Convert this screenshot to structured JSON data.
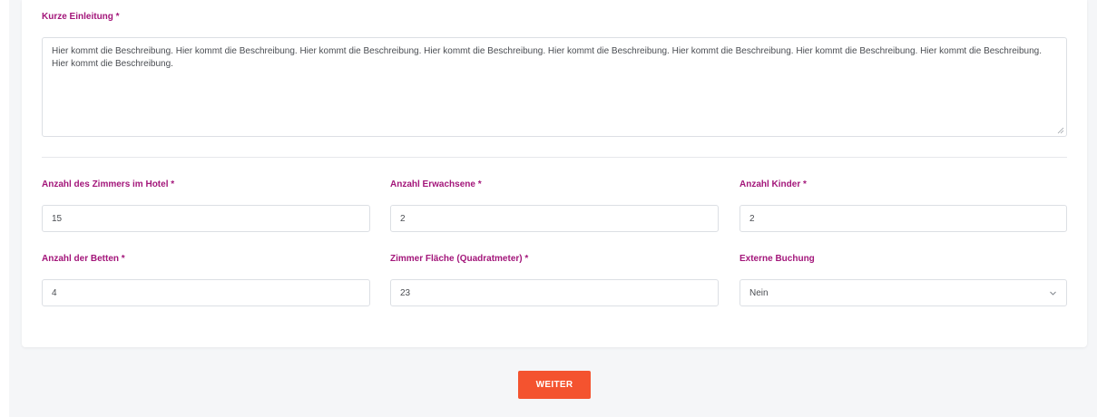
{
  "form": {
    "intro_label": "Kurze Einleitung *",
    "intro_text": "Hier kommt die Beschreibung. Hier kommt die Beschreibung. Hier kommt die Beschreibung. Hier kommt die Beschreibung. Hier kommt die Beschreibung. Hier kommt die Beschreibung. Hier kommt die Beschreibung. Hier kommt die Beschreibung. Hier kommt die Beschreibung.",
    "fields": [
      {
        "label": "Anzahl des Zimmers im Hotel *",
        "value": "15"
      },
      {
        "label": "Anzahl Erwachsene *",
        "value": "2"
      },
      {
        "label": "Anzahl Kinder *",
        "value": "2"
      },
      {
        "label": "Anzahl der Betten *",
        "value": "4"
      },
      {
        "label": "Zimmer Fläche (Quadratmeter) *",
        "value": "23"
      }
    ],
    "external_booking": {
      "label": "Externe Buchung",
      "selected": "Nein",
      "icon": "chevron-down-icon"
    }
  },
  "actions": {
    "next_label": "WEITER"
  },
  "colors": {
    "label": "#a3167a",
    "button": "#f4532f",
    "background": "#f5f6f8"
  }
}
